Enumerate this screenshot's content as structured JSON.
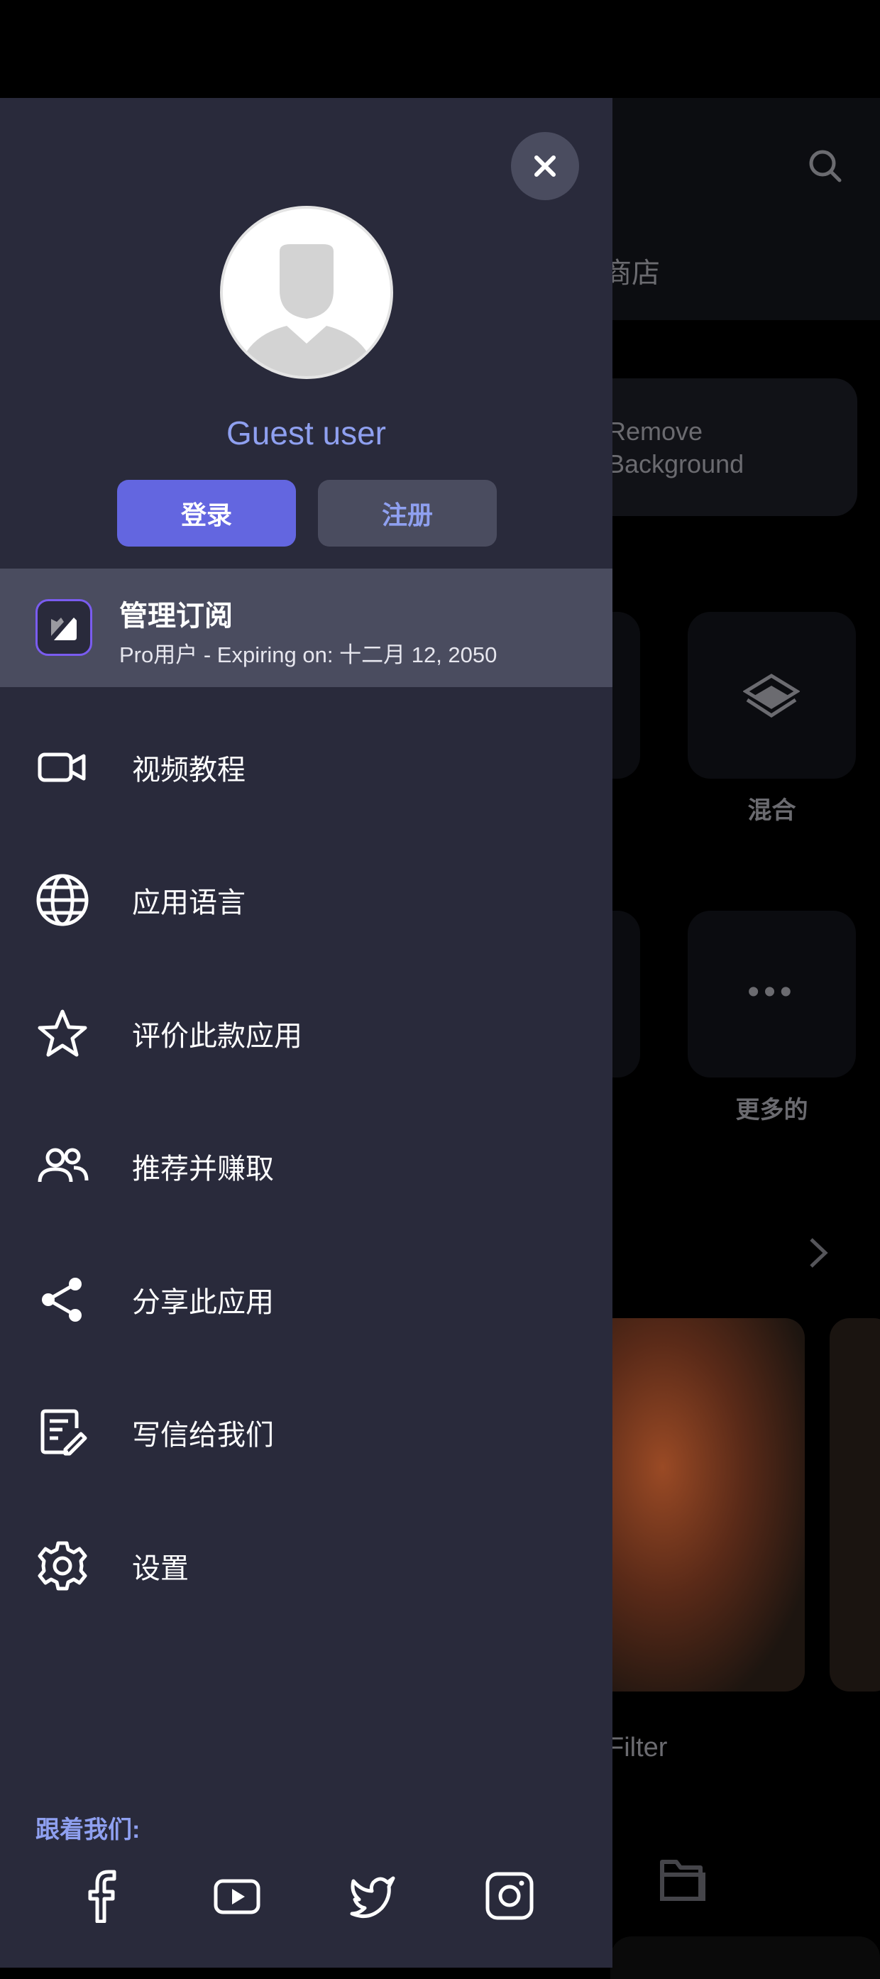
{
  "background": {
    "tab_partial": "商店",
    "remove_bg_card": "Remove\nBackground",
    "tool_blend": "混合",
    "tool_more": "更多的",
    "filter_label": "Filter"
  },
  "drawer": {
    "user_name": "Guest user",
    "login_label": "登录",
    "register_label": "注册",
    "subscription": {
      "title": "管理订阅",
      "subtitle": "Pro用户 - Expiring on: 十二月 12, 2050"
    },
    "menu": [
      {
        "label": "视频教程",
        "icon": "video-camera-icon"
      },
      {
        "label": "应用语言",
        "icon": "globe-icon"
      },
      {
        "label": "评价此款应用",
        "icon": "star-icon"
      },
      {
        "label": "推荐并赚取",
        "icon": "users-icon"
      },
      {
        "label": "分享此应用",
        "icon": "share-icon"
      },
      {
        "label": "写信给我们",
        "icon": "write-icon"
      },
      {
        "label": "设置",
        "icon": "gear-icon"
      }
    ],
    "follow_label": "跟着我们:",
    "social": [
      "facebook-icon",
      "youtube-icon",
      "twitter-icon",
      "instagram-icon"
    ]
  },
  "colors": {
    "accent": "#6366e0",
    "drawer_bg": "#292a3b",
    "selected_row": "#4a4c5f",
    "link": "#8fa0f0"
  }
}
